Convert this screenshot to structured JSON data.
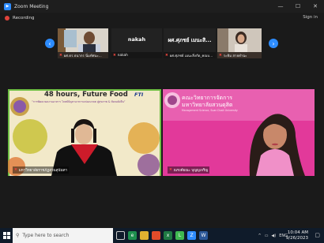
{
  "window": {
    "title": "Zoom Meeting",
    "controls": [
      "minimize-icon",
      "maximize-icon",
      "close-icon"
    ]
  },
  "topbar": {
    "recording_label": "Recording",
    "signin_label": "Sign in"
  },
  "gallery": {
    "thumbnails": [
      {
        "caption": "ผศ.ดร.ธนากร นิ่มทัศนะ...",
        "big_text": ""
      },
      {
        "caption": "nakah",
        "big_text": "nakah"
      },
      {
        "caption": "ผศ.ศุภชย์ เมนะสิ่งกัด_คณบ...",
        "big_text": "ผศ.ศุภชย์ เมนะสิ..."
      },
      {
        "caption": "ระทิม สายทำฉะ",
        "big_text": ""
      }
    ]
  },
  "speakers": {
    "left": {
      "banner_title": "48 hours, Future Food",
      "banner_subtitle": "“การพัฒนาผลงานอาหาร โจทย์ปัญหาอาหารแห่งอนาคต สู่สุขภาพ & สังคมยั่งยืน”",
      "logo_text": "FTI",
      "name_caption": "มหาวิทยาลัยราชภัฏสวนสุนันทา"
    },
    "right": {
      "banner_line1": "คณะวิทยาการจัดการ",
      "banner_line2": "มหาวิทยาลัยสวนดุสิต",
      "banner_line3": "Management Science, Suan Dusit University",
      "name_caption": "ณรงค์ยณะ บุญญเจริญ"
    }
  },
  "taskbar": {
    "search_placeholder": "Type here to search",
    "tray_lang": "ENG",
    "time": "10:04 AM",
    "date": "9/26/2023"
  }
}
